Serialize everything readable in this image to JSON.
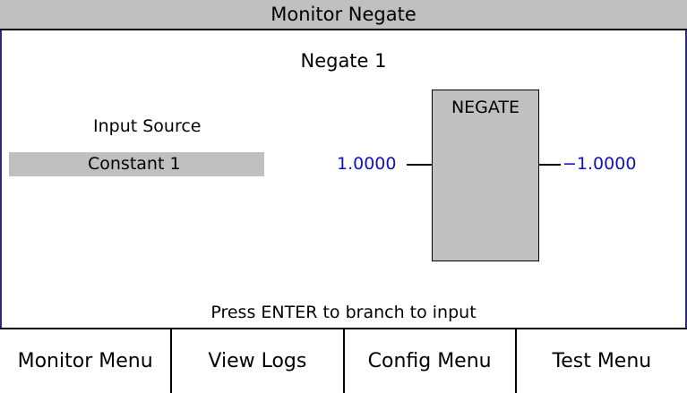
{
  "title": "Monitor Negate",
  "subtitle": "Negate 1",
  "input": {
    "label": "Input Source",
    "value": "Constant 1"
  },
  "block": {
    "label": "NEGATE",
    "input_value": "1.0000",
    "output_value": "−1.0000"
  },
  "prompt": "Press ENTER to branch to input",
  "menu": [
    {
      "label": "Monitor Menu"
    },
    {
      "label": "View Logs"
    },
    {
      "label": "Config Menu"
    },
    {
      "label": "Test Menu"
    }
  ],
  "colors": {
    "value_blue": "#1010c8",
    "panel_gray": "#c0c0c0",
    "frame_border": "#2b2b7a"
  }
}
